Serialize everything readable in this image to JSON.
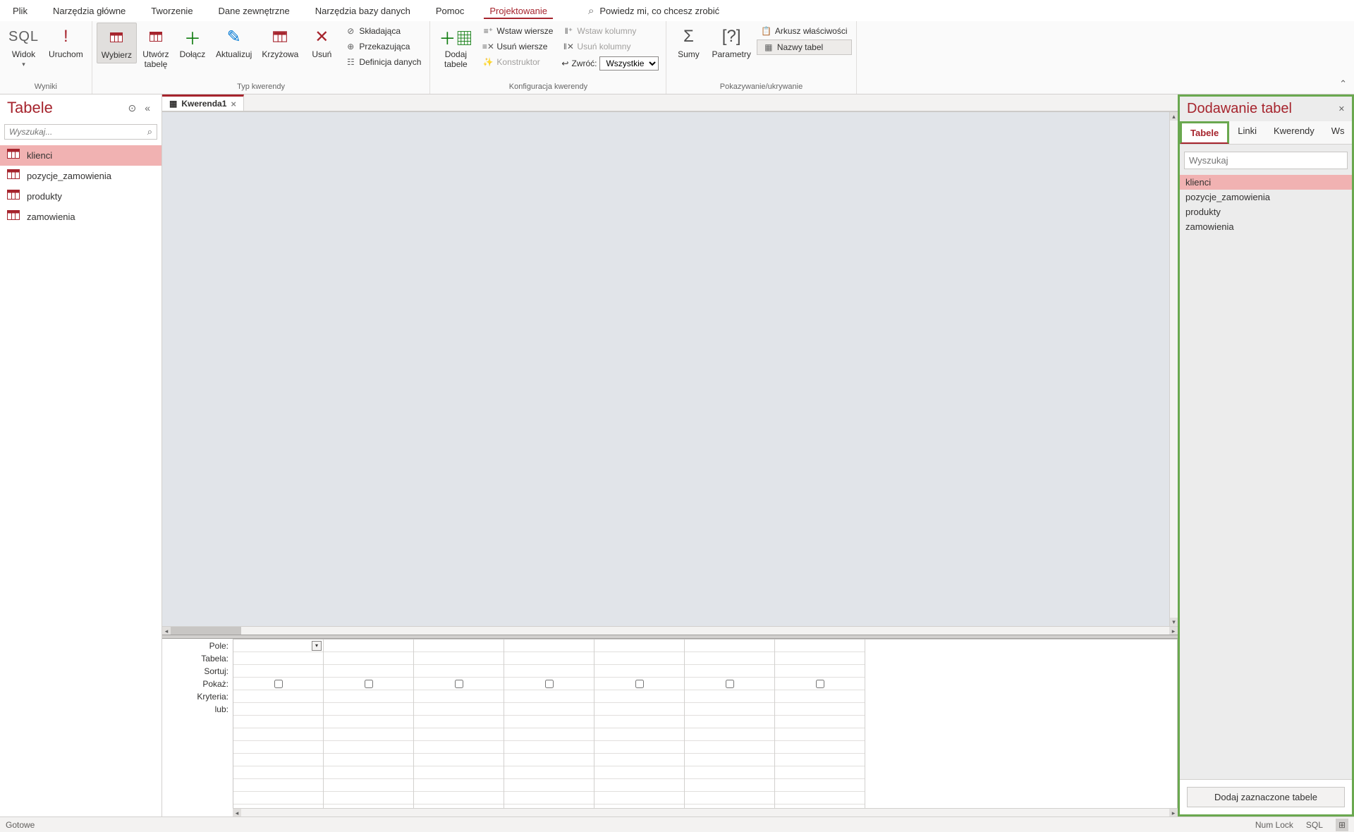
{
  "menu": {
    "items": [
      "Plik",
      "Narzędzia główne",
      "Tworzenie",
      "Dane zewnętrzne",
      "Narzędzia bazy danych",
      "Pomoc",
      "Projektowanie"
    ],
    "active_index": 6,
    "search_prompt": "Powiedz mi, co chcesz zrobić"
  },
  "ribbon": {
    "group_wyniki": {
      "label": "Wyniki",
      "widok": "Widok",
      "uruchom": "Uruchom"
    },
    "group_typ": {
      "label": "Typ kwerendy",
      "wybierz": "Wybierz",
      "utworz": "Utwórz\ntabelę",
      "dolacz": "Dołącz",
      "aktualizuj": "Aktualizuj",
      "krzyzowy": "Krzyżowa",
      "usun": "Usuń",
      "skladajaca": "Składająca",
      "przekazujaca": "Przekazująca",
      "definicja": "Definicja danych"
    },
    "group_konfig": {
      "label": "Konfiguracja kwerendy",
      "dodaj_tabele": "Dodaj\ntabele",
      "wstaw_wiersze": "Wstaw wiersze",
      "usun_wiersze": "Usuń wiersze",
      "konstruktor": "Konstruktor",
      "wstaw_kolumny": "Wstaw kolumny",
      "usun_kolumny": "Usuń kolumny",
      "zwroc": "Zwróć:",
      "zwroc_value": "Wszystkie"
    },
    "group_pokaz": {
      "label": "Pokazywanie/ukrywanie",
      "sumy": "Sumy",
      "parametry": "Parametry",
      "arkusz": "Arkusz właściwości",
      "nazwy_tabel": "Nazwy tabel"
    }
  },
  "left_panel": {
    "title": "Tabele",
    "search_placeholder": "Wyszukaj...",
    "items": [
      "klienci",
      "pozycje_zamowienia",
      "produkty",
      "zamowienia"
    ],
    "selected_index": 0
  },
  "doc_tab": {
    "name": "Kwerenda1"
  },
  "grid_labels": [
    "Pole:",
    "Tabela:",
    "Sortuj:",
    "Pokaż:",
    "Kryteria:",
    "lub:"
  ],
  "right_panel": {
    "title": "Dodawanie tabel",
    "tabs": [
      "Tabele",
      "Linki",
      "Kwerendy",
      "Ws"
    ],
    "active_tab": 0,
    "search_placeholder": "Wyszukaj",
    "items": [
      "klienci",
      "pozycje_zamowienia",
      "produkty",
      "zamowienia"
    ],
    "selected_index": 0,
    "button": "Dodaj zaznaczone tabele"
  },
  "status": {
    "left": "Gotowe",
    "numlock": "Num Lock",
    "sql": "SQL"
  }
}
